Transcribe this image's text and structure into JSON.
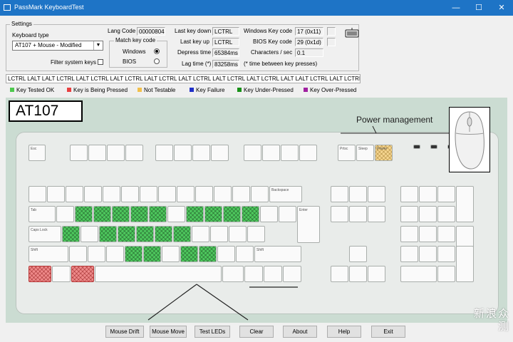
{
  "window": {
    "title": "PassMark KeyboardTest",
    "controls": {
      "minimize": "—",
      "maximize": "☐",
      "close": "✕"
    }
  },
  "settings": {
    "group_label": "Settings",
    "keyboard_type_label": "Keyboard type",
    "keyboard_type_value": "AT107 + Mouse - Modified",
    "filter_system_keys_label": "Filter system keys",
    "lang_code_label": "Lang Code",
    "lang_code_value": "00000804",
    "match_key_code_label": "Match key code",
    "windows_label": "Windows",
    "bios_label": "BIOS",
    "last_key_down_label": "Last key down",
    "last_key_down_value": "LCTRL",
    "last_key_up_label": "Last key up",
    "last_key_up_value": "LCTRL",
    "depress_time_label": "Depress time",
    "depress_time_value": "65384ms",
    "lag_time_label": "Lag time (*)",
    "lag_time_value": "83258ms",
    "windows_key_code_label": "Windows Key code",
    "windows_key_code_value": "17 (0x11)",
    "bios_key_code_label": "BIOS Key code",
    "bios_key_code_value": "29 (0x1d)",
    "chars_per_sec_label": "Characters / sec",
    "chars_per_sec_value": "0.1",
    "lag_note": "(* time between key presses)"
  },
  "key_log": "LCTRL LALT LALT LCTRL LALT LCTRL LALT LCTRL LALT LCTRL LALT LCTRL LALT LCTRL LALT LCTRL LALT LALT LCTRL LALT LCTRL LALT LCTRL LALT LCTRL LCTRL LALT",
  "legend": [
    {
      "label": "Key Tested OK",
      "color": "#4ec94e"
    },
    {
      "label": "Key is Being Pressed",
      "color": "#e84040"
    },
    {
      "label": "Not Testable",
      "color": "#f2c04c"
    },
    {
      "label": "Key Failure",
      "color": "#2030c8"
    },
    {
      "label": "Key Under-Pressed",
      "color": "#189018"
    },
    {
      "label": "Key Over-Pressed",
      "color": "#a020a0"
    }
  ],
  "keyboard": {
    "title": "AT107",
    "power_management_label": "Power management",
    "key_labels": {
      "esc": "Esc",
      "tab": "Tab",
      "caps": "Caps Lock",
      "shift": "Shift",
      "enter": "Enter",
      "backspace": "Backspace",
      "prtsc": "Prtsc",
      "sleep": "Sleep",
      "power": "Power"
    }
  },
  "buttons": {
    "mouse_drift": "Mouse Drift",
    "mouse_move": "Mouse Move",
    "test_leds": "Test LEDs",
    "clear": "Clear",
    "about": "About",
    "help": "Help",
    "exit": "Exit"
  },
  "watermark": "新浪众测"
}
